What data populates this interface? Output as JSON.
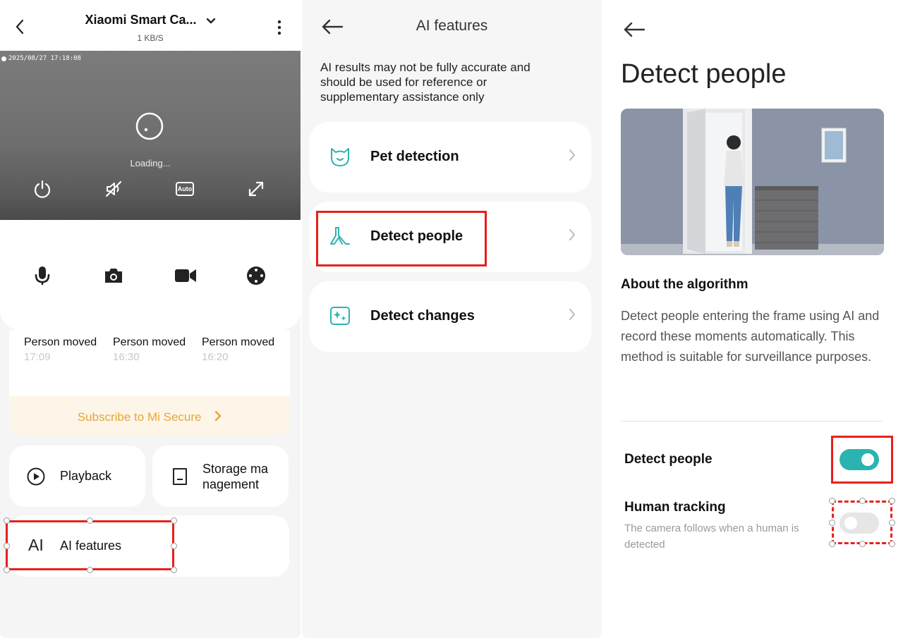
{
  "panel_camera": {
    "title": "Xiaomi Smart Ca...",
    "speed": "1 KB/S",
    "timestamp": "2025/08/27 17:18:08",
    "loading": "Loading...",
    "auto_label": "Auto",
    "events": [
      {
        "title": "Person moved",
        "time": "17:09"
      },
      {
        "title": "Person moved",
        "time": "16:30"
      },
      {
        "title": "Person moved",
        "time": "16:20"
      }
    ],
    "subscribe": "Subscribe to Mi Secure",
    "playback": "Playback",
    "storage_line1": "Storage ma",
    "storage_line2": "nagement",
    "ai_icon_text": "AI",
    "ai_features": "AI features"
  },
  "panel_ai": {
    "title": "AI features",
    "disclaimer": "AI results may not be fully accurate and should be used for reference or supplementary assistance only",
    "items": [
      {
        "label": "Pet detection",
        "icon": "pet-icon"
      },
      {
        "label": "Detect people",
        "icon": "person-icon"
      },
      {
        "label": "Detect changes",
        "icon": "sparkle-icon"
      }
    ]
  },
  "panel_detect": {
    "title": "Detect people",
    "about_heading": "About the algorithm",
    "about_text": "Detect people entering the frame using AI and record these moments automatically. This method is suitable for surveillance purposes.",
    "detect_people_label": "Detect people",
    "detect_people_on": true,
    "human_tracking_label": "Human tracking",
    "human_tracking_desc": "The camera follows when a human is detected",
    "human_tracking_on": false
  },
  "colors": {
    "accent_teal": "#2bb3b1",
    "subscribe_orange": "#e8a43a",
    "highlight_red": "#e8201c"
  }
}
